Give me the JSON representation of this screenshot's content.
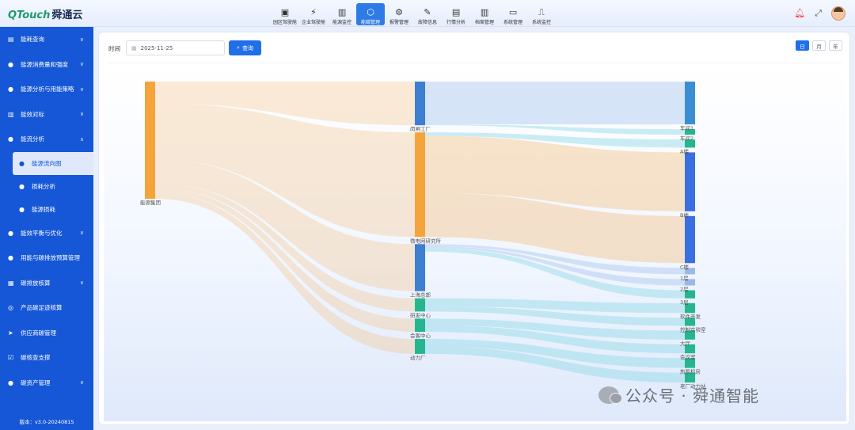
{
  "app": {
    "logo_en": "QTouch",
    "logo_cn": "舜通云"
  },
  "nav": [
    {
      "label": "园区驾驶舱",
      "icon": "dashboard-icon",
      "glyph": "▣"
    },
    {
      "label": "企业驾驶舱",
      "icon": "lightning-icon",
      "glyph": "⚡"
    },
    {
      "label": "能源监控",
      "icon": "bar-chart-icon",
      "glyph": "▥"
    },
    {
      "label": "能碳管理",
      "icon": "energy-carbon-icon",
      "glyph": "⬡",
      "active": true
    },
    {
      "label": "报警管理",
      "icon": "alarm-icon",
      "glyph": "⚙"
    },
    {
      "label": "故障信息",
      "icon": "edit-icon",
      "glyph": "✎"
    },
    {
      "label": "行情分析",
      "icon": "analysis-icon",
      "glyph": "▤"
    },
    {
      "label": "档案管理",
      "icon": "archive-icon",
      "glyph": "▥"
    },
    {
      "label": "系统管理",
      "icon": "monitor-icon",
      "glyph": "▭"
    },
    {
      "label": "系统监控",
      "icon": "system-monitor-icon",
      "glyph": "⎍"
    }
  ],
  "sidebar": {
    "items": [
      {
        "label": "能耗查询",
        "icon": "query-icon",
        "glyph": "▤",
        "chev": "∨"
      },
      {
        "label": "能源消费量和强度",
        "icon": "consumption-icon",
        "glyph": "●",
        "chev": "∨"
      },
      {
        "label": "能源分析与用能策略",
        "icon": "strategy-icon",
        "glyph": "●",
        "chev": "∨"
      },
      {
        "label": "能效对标",
        "icon": "benchmark-icon",
        "glyph": "▥",
        "chev": "∨"
      },
      {
        "label": "能流分析",
        "icon": "flow-icon",
        "glyph": "●",
        "chev": "∧"
      }
    ],
    "subitems": [
      {
        "label": "能源流向图",
        "icon": "sankey-icon",
        "glyph": "●",
        "active": true
      },
      {
        "label": "损耗分析",
        "icon": "loss-analysis-icon",
        "glyph": "●"
      },
      {
        "label": "能源损耗",
        "icon": "energy-loss-icon",
        "glyph": "●"
      }
    ],
    "items_after": [
      {
        "label": "能效平衡与优化",
        "icon": "balance-icon",
        "glyph": "●",
        "chev": "∨"
      },
      {
        "label": "用能与碳排放预算管理",
        "icon": "budget-icon",
        "glyph": "●",
        "chev": ""
      },
      {
        "label": "碳排放核算",
        "icon": "carbon-accounting-icon",
        "glyph": "▦",
        "chev": "∨"
      },
      {
        "label": "产品碳足迹核算",
        "icon": "footprint-icon",
        "glyph": "◎",
        "chev": ""
      },
      {
        "label": "供应商碳管理",
        "icon": "supplier-icon",
        "glyph": "➤",
        "chev": ""
      },
      {
        "label": "碳核查支撑",
        "icon": "verify-icon",
        "glyph": "☑",
        "chev": ""
      },
      {
        "label": "碳资产管理",
        "icon": "asset-icon",
        "glyph": "●",
        "chev": "∨"
      }
    ],
    "version": "版本：v3.0-20240815"
  },
  "filter": {
    "time_label": "时间",
    "date_value": "2025-11-25",
    "query_label": "查询",
    "periods": [
      {
        "label": "日",
        "active": true
      },
      {
        "label": "月",
        "active": false
      },
      {
        "label": "年",
        "active": false
      }
    ]
  },
  "chart_data": {
    "type": "sankey",
    "nodes": [
      {
        "name": "能源集团",
        "level": 0,
        "color": "#f4a43a"
      },
      {
        "name": "闵闸工厂",
        "level": 1,
        "color": "#3e7fd1"
      },
      {
        "name": "微电网研究所",
        "level": 1,
        "color": "#f4a43a"
      },
      {
        "name": "上海总部",
        "level": 1,
        "color": "#3e7fd1"
      },
      {
        "name": "研发中心",
        "level": 1,
        "color": "#26b68f"
      },
      {
        "name": "会客中心",
        "level": 1,
        "color": "#26b68f"
      },
      {
        "name": "动力厂",
        "level": 1,
        "color": "#26b68f"
      },
      {
        "name": "车间1",
        "level": 2,
        "color": "#3a8fd4"
      },
      {
        "name": "车间2",
        "level": 2,
        "color": "#26b68f"
      },
      {
        "name": "A楼",
        "level": 2,
        "color": "#26b68f"
      },
      {
        "name": "B楼",
        "level": 2,
        "color": "#3a6fe0"
      },
      {
        "name": "C楼",
        "level": 2,
        "color": "#3a6fe0"
      },
      {
        "name": "1层",
        "level": 2,
        "color": "#9bb8e6"
      },
      {
        "name": "2层",
        "level": 2,
        "color": "#9bb8e6"
      },
      {
        "name": "3层",
        "level": 2,
        "color": "#26b68f"
      },
      {
        "name": "软件开发",
        "level": 2,
        "color": "#26b68f"
      },
      {
        "name": "控制实验室",
        "level": 2,
        "color": "#26b68f"
      },
      {
        "name": "大厅",
        "level": 2,
        "color": "#26b68f"
      },
      {
        "name": "会议室",
        "level": 2,
        "color": "#26b68f"
      },
      {
        "name": "热泵机房",
        "level": 2,
        "color": "#26b68f"
      },
      {
        "name": "老厂动力站",
        "level": 2,
        "color": "#26b68f"
      }
    ],
    "links": [
      {
        "source": "能源集团",
        "target": "闵闸工厂",
        "value": 46
      },
      {
        "source": "能源集团",
        "target": "微电网研究所",
        "value": 118
      },
      {
        "source": "能源集团",
        "target": "上海总部",
        "value": 50
      },
      {
        "source": "能源集团",
        "target": "研发中心",
        "value": 10
      },
      {
        "source": "能源集团",
        "target": "会客中心",
        "value": 10
      },
      {
        "source": "能源集团",
        "target": "动力厂",
        "value": 12
      },
      {
        "source": "闵闸工厂",
        "target": "车间1",
        "value": 45
      },
      {
        "source": "闵闸工厂",
        "target": "车间2",
        "value": 1
      },
      {
        "source": "微电网研究所",
        "target": "A楼",
        "value": 4
      },
      {
        "source": "微电网研究所",
        "target": "B楼",
        "value": 64
      },
      {
        "source": "微电网研究所",
        "target": "C楼",
        "value": 50
      },
      {
        "source": "上海总部",
        "target": "1层",
        "value": 2
      },
      {
        "source": "上海总部",
        "target": "2层",
        "value": 2
      },
      {
        "source": "上海总部",
        "target": "3层",
        "value": 4
      },
      {
        "source": "研发中心",
        "target": "软件开发",
        "value": 6
      },
      {
        "source": "研发中心",
        "target": "控制实验室",
        "value": 4
      },
      {
        "source": "会客中心",
        "target": "大厅",
        "value": 5
      },
      {
        "source": "会客中心",
        "target": "会议室",
        "value": 5
      },
      {
        "source": "动力厂",
        "target": "热泵机房",
        "value": 6
      },
      {
        "source": "动力厂",
        "target": "老厂动力站",
        "value": 6
      }
    ]
  },
  "watermark": {
    "text": "公众号 · 舜通智能"
  }
}
